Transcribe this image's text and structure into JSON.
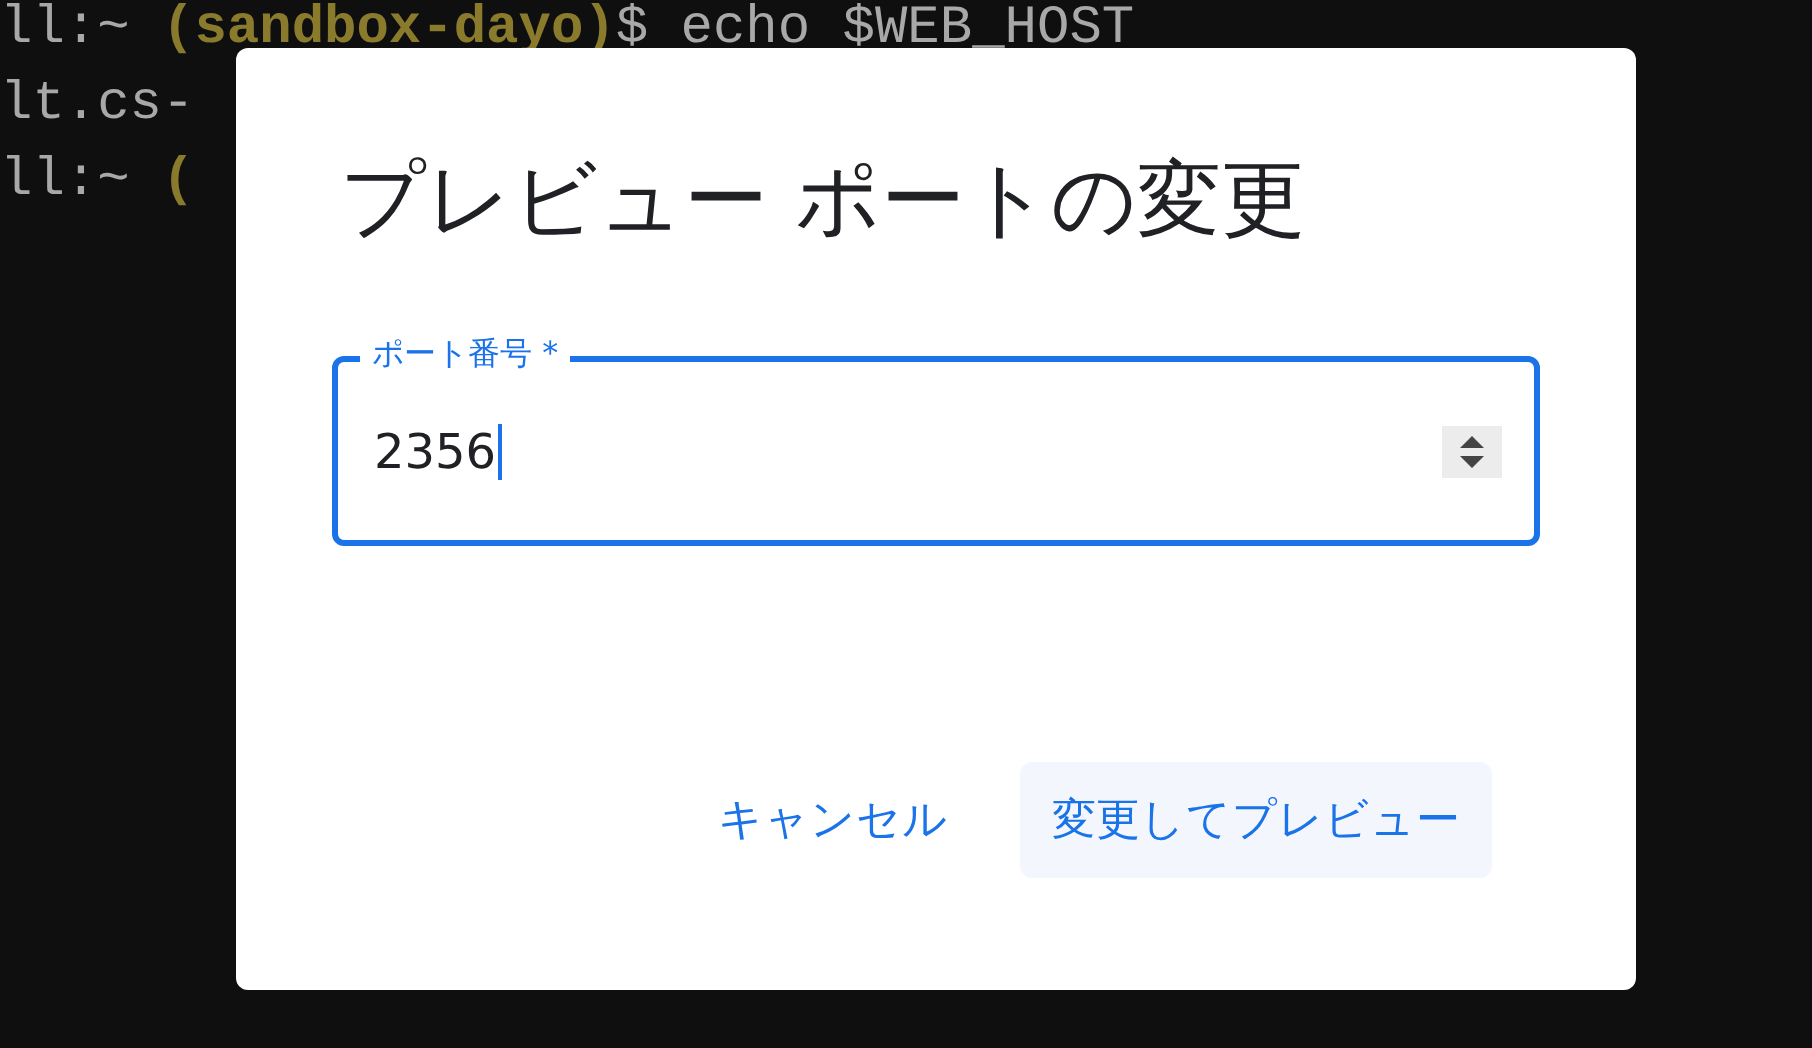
{
  "terminal": {
    "lines": [
      {
        "segments": [
          {
            "kind": "plain",
            "text": "ll:~ "
          },
          {
            "kind": "env",
            "text": "(sandbox-dayo)"
          },
          {
            "kind": "plain",
            "text": "$ echo $WEB_HOST"
          }
        ]
      },
      {
        "segments": [
          {
            "kind": "plain",
            "text": "lt.cs-"
          }
        ]
      },
      {
        "segments": [
          {
            "kind": "plain",
            "text": "ll:~ "
          },
          {
            "kind": "env",
            "text": "("
          }
        ]
      }
    ]
  },
  "dialog": {
    "title": "プレビュー ポートの変更",
    "field": {
      "label": "ポート番号 *",
      "value": "2356",
      "focused": true
    },
    "buttons": [
      {
        "kind": "text",
        "label": "キャンセル"
      },
      {
        "kind": "tonal",
        "label": "変更してプレビュー"
      }
    ]
  }
}
